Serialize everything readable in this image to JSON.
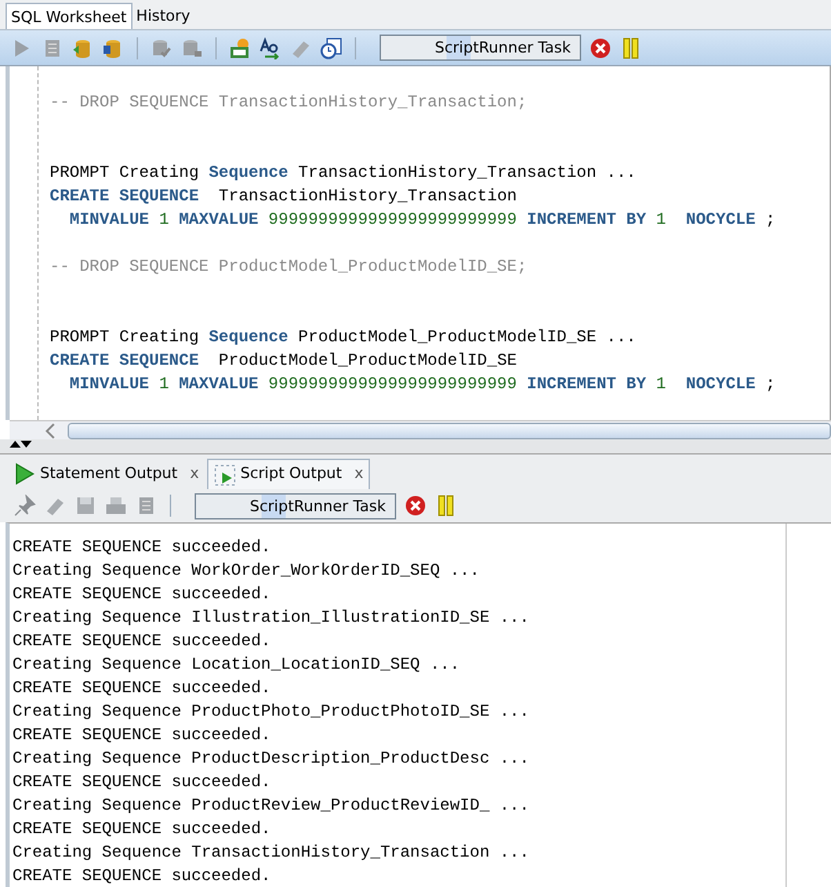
{
  "top_tabs": [
    {
      "label": "SQL Worksheet",
      "selected": true
    },
    {
      "label": "History",
      "selected": false
    }
  ],
  "task_field": {
    "value": "ScriptRunner Task"
  },
  "editor": {
    "lines": [
      {
        "kind": "blank"
      },
      {
        "kind": "code",
        "segments": [
          {
            "kind": "comment",
            "text": "-- DROP SEQUENCE TransactionHistory_Transaction;"
          }
        ]
      },
      {
        "kind": "blank"
      },
      {
        "kind": "blank"
      },
      {
        "kind": "code",
        "segments": [
          {
            "kind": "plain",
            "text": "PROMPT Creating"
          },
          {
            "kind": "keyword",
            "text": "Sequence"
          },
          {
            "kind": "plain",
            "text": "TransactionHistory_Transaction ..."
          }
        ]
      },
      {
        "kind": "code",
        "segments": [
          {
            "kind": "keyword",
            "text": "CREATE SEQUENCE"
          },
          {
            "kind": "plain",
            "text": " TransactionHistory_Transaction"
          }
        ]
      },
      {
        "kind": "code",
        "indent": true,
        "segments": [
          {
            "kind": "keyword",
            "text": "MINVALUE"
          },
          {
            "kind": "number",
            "text": "1"
          },
          {
            "kind": "keyword",
            "text": "MAXVALUE"
          },
          {
            "kind": "number",
            "text": "9999999999999999999999999"
          },
          {
            "kind": "keyword",
            "text": "INCREMENT BY"
          },
          {
            "kind": "number",
            "text": "1"
          },
          {
            "kind": "keyword",
            "text": " NOCYCLE"
          },
          {
            "kind": "plain",
            "text": ";"
          }
        ]
      },
      {
        "kind": "blank"
      },
      {
        "kind": "code",
        "segments": [
          {
            "kind": "comment",
            "text": "-- DROP SEQUENCE ProductModel_ProductModelID_SE;"
          }
        ]
      },
      {
        "kind": "blank"
      },
      {
        "kind": "blank"
      },
      {
        "kind": "code",
        "segments": [
          {
            "kind": "plain",
            "text": "PROMPT Creating"
          },
          {
            "kind": "keyword",
            "text": "Sequence"
          },
          {
            "kind": "plain",
            "text": "ProductModel_ProductModelID_SE ..."
          }
        ]
      },
      {
        "kind": "code",
        "segments": [
          {
            "kind": "keyword",
            "text": "CREATE SEQUENCE"
          },
          {
            "kind": "plain",
            "text": " ProductModel_ProductModelID_SE"
          }
        ]
      },
      {
        "kind": "code",
        "indent": true,
        "segments": [
          {
            "kind": "keyword",
            "text": "MINVALUE"
          },
          {
            "kind": "number",
            "text": "1"
          },
          {
            "kind": "keyword",
            "text": "MAXVALUE"
          },
          {
            "kind": "number",
            "text": "9999999999999999999999999"
          },
          {
            "kind": "keyword",
            "text": "INCREMENT BY"
          },
          {
            "kind": "number",
            "text": "1"
          },
          {
            "kind": "keyword",
            "text": " NOCYCLE"
          },
          {
            "kind": "plain",
            "text": ";"
          }
        ]
      }
    ]
  },
  "output_tabs": [
    {
      "label": "Statement Output",
      "close": "x",
      "selected": false
    },
    {
      "label": "Script Output",
      "close": "x",
      "selected": true
    }
  ],
  "output_task_field": {
    "value": "ScriptRunner Task"
  },
  "output_lines": [
    "CREATE SEQUENCE succeeded.",
    "Creating Sequence WorkOrder_WorkOrderID_SEQ ...",
    "CREATE SEQUENCE succeeded.",
    "Creating Sequence Illustration_IllustrationID_SE ...",
    "CREATE SEQUENCE succeeded.",
    "Creating Sequence Location_LocationID_SEQ ...",
    "CREATE SEQUENCE succeeded.",
    "Creating Sequence ProductPhoto_ProductPhotoID_SE ...",
    "CREATE SEQUENCE succeeded.",
    "Creating Sequence ProductDescription_ProductDesc ...",
    "CREATE SEQUENCE succeeded.",
    "Creating Sequence ProductReview_ProductReviewID_ ...",
    "CREATE SEQUENCE succeeded.",
    "Creating Sequence TransactionHistory_Transaction ...",
    "CREATE SEQUENCE succeeded."
  ]
}
